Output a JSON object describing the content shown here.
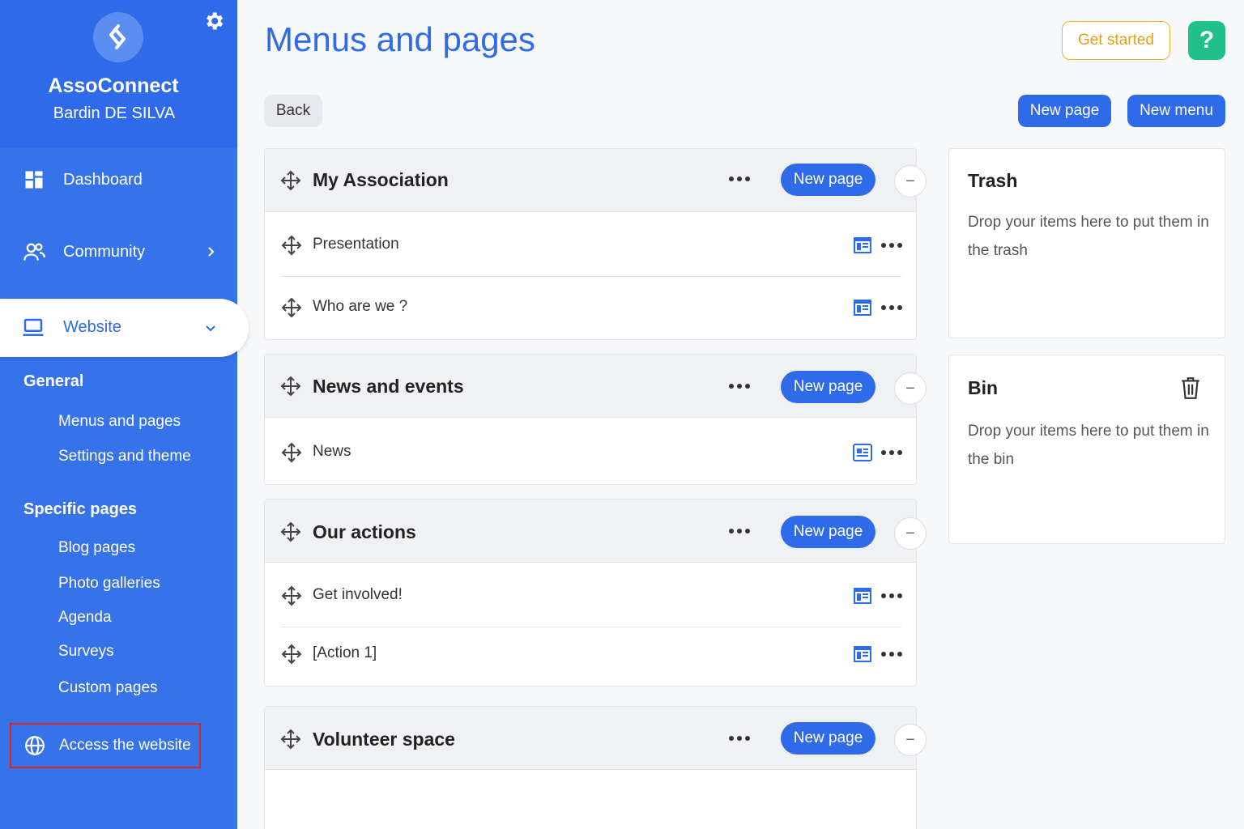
{
  "sidebar": {
    "org_name": "AssoConnect",
    "user_name": "Bardin DE SILVA",
    "nav": {
      "dashboard": "Dashboard",
      "community": "Community",
      "website": "Website"
    },
    "general_title": "General",
    "general_items": [
      "Menus and pages",
      "Settings and theme"
    ],
    "specific_title": "Specific pages",
    "specific_items": [
      "Blog pages",
      "Photo galleries",
      "Agenda",
      "Surveys",
      "Custom pages"
    ],
    "access_label": "Access the website"
  },
  "header": {
    "title": "Menus and pages",
    "get_started": "Get started",
    "help": "?"
  },
  "toolbar": {
    "back": "Back",
    "new_page": "New page",
    "new_menu": "New menu"
  },
  "menus": [
    {
      "title": "My Association",
      "new_page": "New page",
      "items": [
        "Presentation",
        "Who are we ?"
      ]
    },
    {
      "title": "News and events",
      "new_page": "New page",
      "items": [
        "News"
      ]
    },
    {
      "title": "Our actions",
      "new_page": "New page",
      "items": [
        "Get involved!",
        "[Action 1]"
      ]
    },
    {
      "title": "Volunteer space",
      "new_page": "New page",
      "items": []
    }
  ],
  "trash": {
    "title": "Trash",
    "text": "Drop your items here to put them in the trash"
  },
  "bin": {
    "title": "Bin",
    "text": "Drop your items here to put them in the bin"
  },
  "colors": {
    "sidebar": "#3672ea",
    "accent": "#2f6ae8",
    "get_started": "#f0b429",
    "help": "#1fc08a",
    "highlight": "#e02424"
  }
}
